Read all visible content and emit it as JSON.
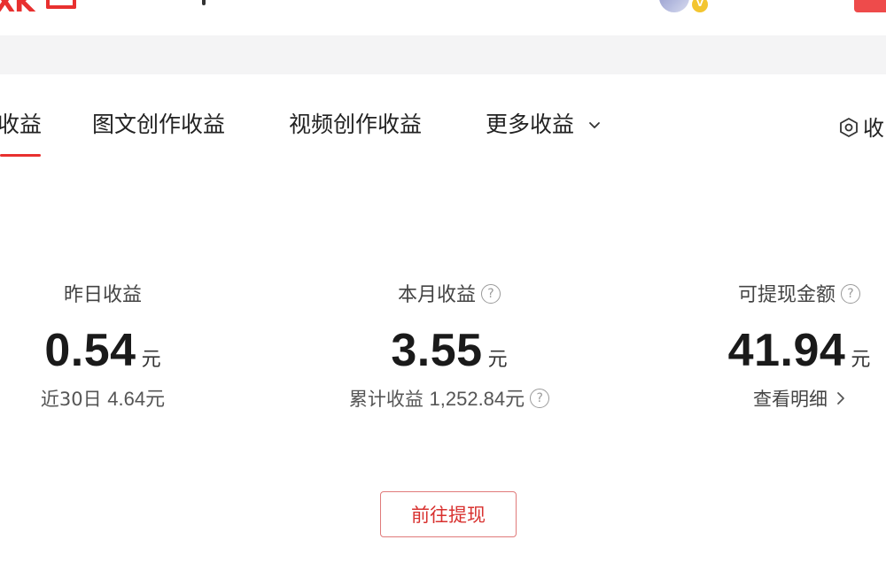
{
  "header": {
    "logo_text": "XK",
    "avatar_badge": "V"
  },
  "tabs": [
    {
      "label": "收益",
      "active": true
    },
    {
      "label": "图文创作收益",
      "active": false
    },
    {
      "label": "视频创作收益",
      "active": false
    },
    {
      "label": "更多收益",
      "active": false,
      "has_dropdown": true
    }
  ],
  "settings_label": "收",
  "stats": {
    "yesterday": {
      "label": "昨日收益",
      "value": "0.54",
      "unit": "元",
      "sub_label": "近30日",
      "sub_value": "4.64元"
    },
    "month": {
      "label": "本月收益",
      "value": "3.55",
      "unit": "元",
      "sub_label": "累计收益",
      "sub_value": "1,252.84元"
    },
    "withdrawable": {
      "label": "可提现金额",
      "value": "41.94",
      "unit": "元",
      "detail_link": "查看明细"
    }
  },
  "withdraw_button": "前往提现",
  "colors": {
    "accent": "#e8302f",
    "band": "#f4f4f5",
    "text": "#222222",
    "muted": "#9a9a9a"
  },
  "icons": {
    "help": "help-circle-icon",
    "chevron_down": "chevron-down-icon",
    "chevron_right": "chevron-right-icon",
    "settings": "settings-hexagon-icon"
  }
}
